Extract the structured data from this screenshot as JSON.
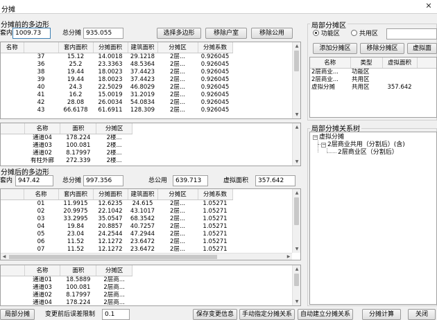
{
  "window": {
    "title": "分摊"
  },
  "before": {
    "section_label": "分摊前的多边形",
    "inner_label": "套内",
    "inner_value": "1009.73",
    "total_label": "总分摊",
    "total_value": "935.055",
    "btn_select": "选择多边形",
    "btn_remove_unit": "移除户室",
    "btn_remove_public": "移除公用",
    "headers": [
      "名称",
      "套内面积",
      "分摊面积",
      "建筑面积",
      "分摊区",
      "分摊系数"
    ],
    "rows": [
      [
        "37",
        "15.12",
        "14.0018",
        "29.1218",
        "2层...",
        "0.926045"
      ],
      [
        "36",
        "25.2",
        "23.3363",
        "48.5364",
        "2层...",
        "0.926045"
      ],
      [
        "38",
        "19.44",
        "18.0023",
        "37.4423",
        "2层...",
        "0.926045"
      ],
      [
        "39",
        "19.44",
        "18.0023",
        "37.4423",
        "2层...",
        "0.926045"
      ],
      [
        "40",
        "24.3",
        "22.5029",
        "46.8029",
        "2层...",
        "0.926045"
      ],
      [
        "41",
        "16.2",
        "15.0019",
        "31.2019",
        "2层...",
        "0.926045"
      ],
      [
        "42",
        "28.08",
        "26.0034",
        "54.0834",
        "2层...",
        "0.926045"
      ],
      [
        "43",
        "66.6178",
        "61.6911",
        "128.309",
        "2层...",
        "0.926045"
      ]
    ],
    "public_headers": [
      "名称",
      "面积",
      "分摊区"
    ],
    "public_rows": [
      [
        "通道04",
        "178.224",
        "2楼..."
      ],
      [
        "通道03",
        "100.081",
        "2楼..."
      ],
      [
        "通道02",
        "8.17997",
        "2楼..."
      ],
      [
        "有柱外廊",
        "272.339",
        "2楼..."
      ]
    ]
  },
  "after": {
    "section_label": "分摊后的多边形",
    "inner_label": "套内",
    "inner_value": "947.42",
    "total_label": "总分摊",
    "total_value": "997.356",
    "public_total_label": "总公用",
    "public_total_value": "639.713",
    "virtual_label": "虚拟面积",
    "virtual_value": "357.642",
    "headers": [
      "名称",
      "套内面积",
      "分摊面积",
      "建筑面积",
      "分摊区",
      "分摊系数"
    ],
    "rows": [
      [
        "01",
        "11.9915",
        "12.6235",
        "24.615",
        "2层...",
        "1.05271"
      ],
      [
        "02",
        "20.9975",
        "22.1042",
        "43.1017",
        "2层...",
        "1.05271"
      ],
      [
        "03",
        "33.2995",
        "35.0547",
        "68.3542",
        "2层...",
        "1.05271"
      ],
      [
        "04",
        "19.84",
        "20.8857",
        "40.7257",
        "2层...",
        "1.05271"
      ],
      [
        "05",
        "23.04",
        "24.2544",
        "47.2944",
        "2层...",
        "1.05271"
      ],
      [
        "06",
        "11.52",
        "12.1272",
        "23.6472",
        "2层...",
        "1.05271"
      ],
      [
        "07",
        "11.52",
        "12.1272",
        "23.6472",
        "2层...",
        "1.05271"
      ]
    ],
    "public_headers": [
      "名称",
      "面积",
      "分摊区"
    ],
    "public_rows": [
      [
        "通道01",
        "18.5889",
        "2层商..."
      ],
      [
        "通道03",
        "100.081",
        "2层商..."
      ],
      [
        "通道02",
        "8.17997",
        "2层商..."
      ],
      [
        "通道04",
        "178.224",
        "2层商..."
      ]
    ]
  },
  "local": {
    "section_label": "局部分摊区",
    "radio_function": "功能区",
    "radio_public": "共用区",
    "search_value": "",
    "btn_add": "添加分摊区",
    "btn_remove": "移除分摊区",
    "btn_virtual": "虚拟面",
    "headers": [
      "名称",
      "类型",
      "虚拟面积"
    ],
    "rows": [
      [
        "2层商业...",
        "功能区",
        ""
      ],
      [
        "2层商业...",
        "共用区",
        ""
      ],
      [
        "虚拟分摊",
        "共用区",
        "357.642"
      ]
    ]
  },
  "relation": {
    "section_label": "局部分摊关系树",
    "root": "虚拟分摊",
    "child": "2层商业共用（分割后）(含)",
    "grandchild": "2层商业区（分割后）"
  },
  "footer": {
    "btn_local": "局部分摊",
    "limit_label": "变更前后误差限制",
    "limit_value": "0.1",
    "btn_save": "保存变更信息",
    "btn_manual": "手动指定分摊关系",
    "btn_auto": "自动建立分摊关系",
    "btn_calc": "分摊计算",
    "btn_close": "关闭"
  }
}
